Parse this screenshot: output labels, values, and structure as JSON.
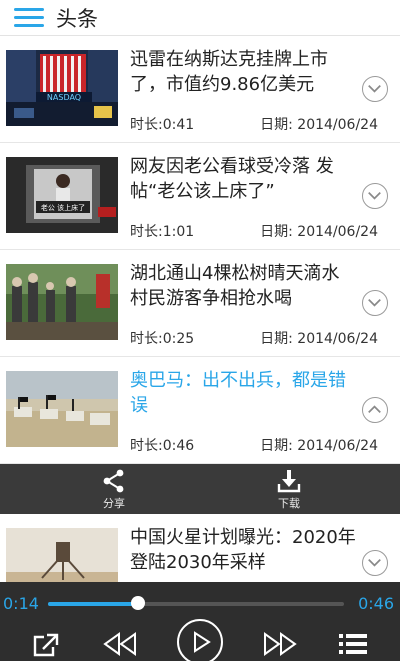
{
  "header": {
    "title": "头条"
  },
  "items": [
    {
      "title": "迅雷在纳斯达克挂牌上市了，市值约9.86亿美元",
      "duration": "时长:0:41",
      "date": "日期: 2014/06/24",
      "thumb_text": "NASDAQ"
    },
    {
      "title": "网友因老公看球受冷落 发帖“老公该上床了”",
      "duration": "时长:1:01",
      "date": "日期: 2014/06/24",
      "thumb_text": "老公 该上床了"
    },
    {
      "title": "湖北通山4棵松树晴天滴水村民游客争相抢水喝",
      "duration": "时长:0:25",
      "date": "日期: 2014/06/24"
    },
    {
      "title": "奥巴马：出不出兵，都是错误",
      "duration": "时长:0:46",
      "date": "日期: 2014/06/24"
    }
  ],
  "actions": {
    "share_label": "分享",
    "download_label": "下载"
  },
  "partial_item": {
    "title": "中国火星计划曝光：2020年登陆2030年采样"
  },
  "player": {
    "current_time": "0:14",
    "total_time": "0:46",
    "progress": 0.304
  },
  "colors": {
    "accent": "#2aa6e8",
    "bar_dark": "#3a3a3a",
    "player_bg": "#2e2e2e"
  }
}
